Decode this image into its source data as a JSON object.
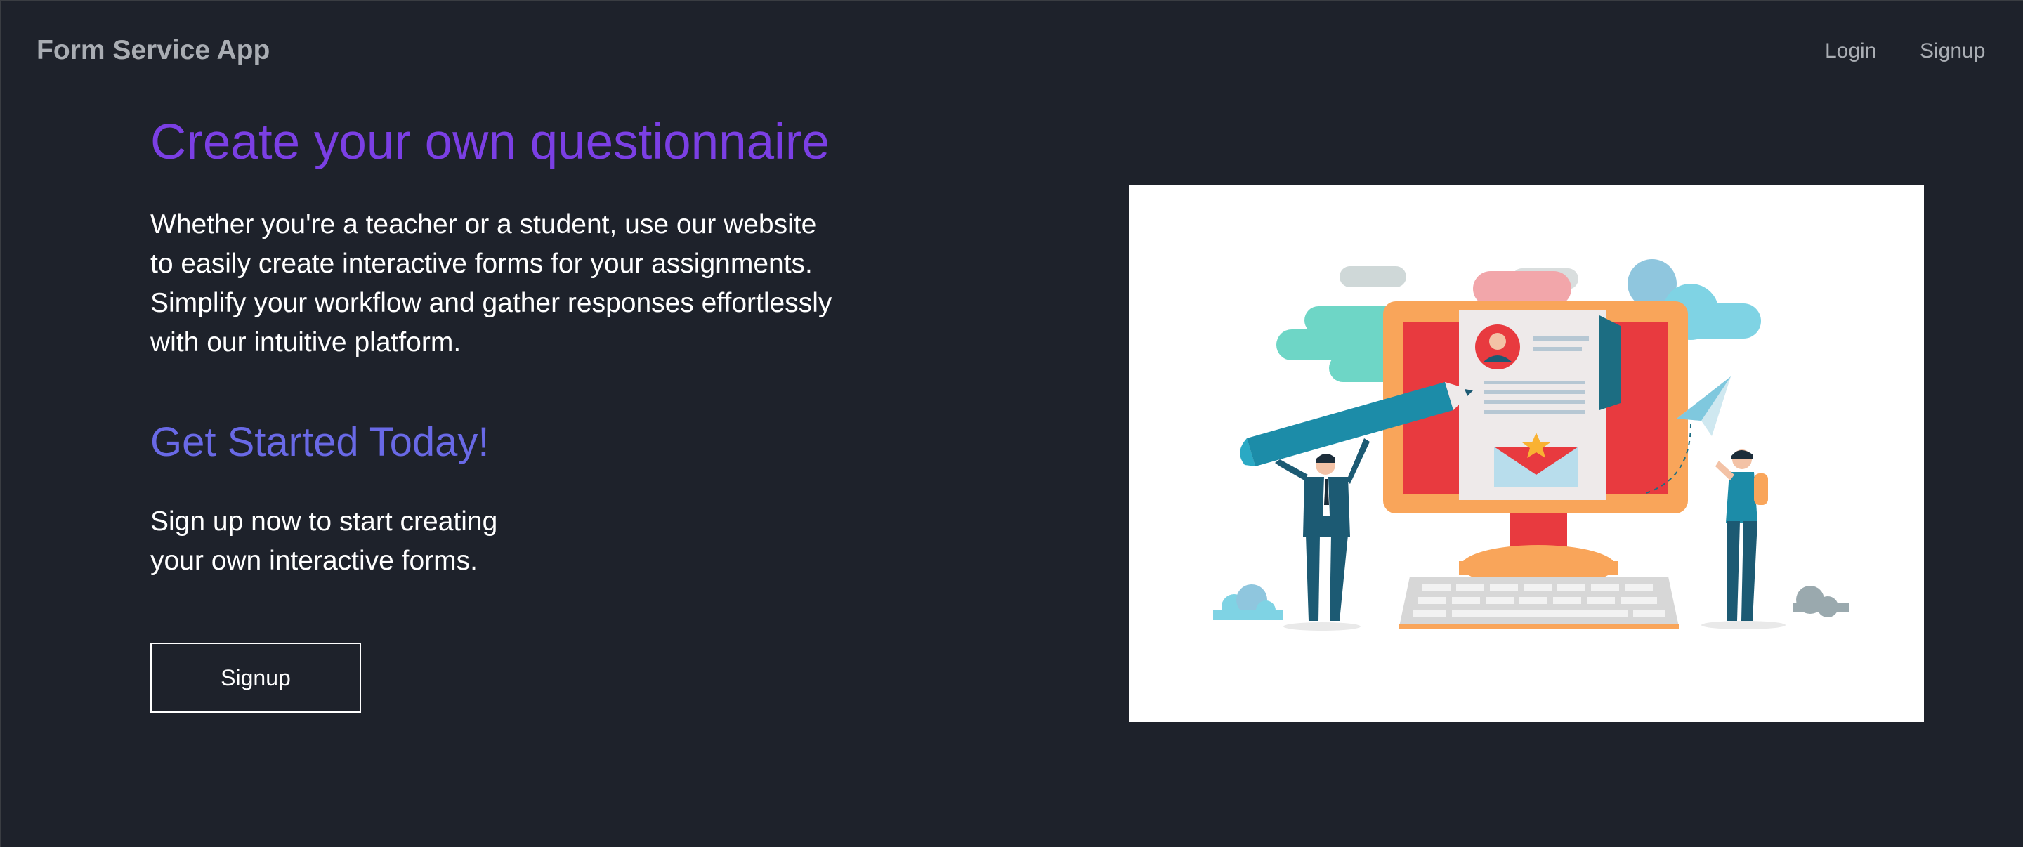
{
  "navbar": {
    "brand": "Form Service App",
    "links": [
      {
        "label": "Login"
      },
      {
        "label": "Signup"
      }
    ]
  },
  "hero": {
    "title": "Create your own questionnaire",
    "lines": [
      "Whether you're a teacher or a student, use our website",
      "to easily create interactive forms for your assignments.",
      "Simplify your workflow and gather responses effortlessly",
      "with our intuitive platform."
    ]
  },
  "cta": {
    "title": "Get Started Today!",
    "lines": [
      "Sign up now to start creating",
      "your own interactive forms."
    ],
    "button_label": "Signup"
  },
  "colors": {
    "background": "#1e222b",
    "title_purple": "#7b3fe4",
    "subtitle_indigo": "#6969e6",
    "nav_text": "#a9adb3"
  },
  "illustration": {
    "icon": "questionnaire-illustration"
  }
}
